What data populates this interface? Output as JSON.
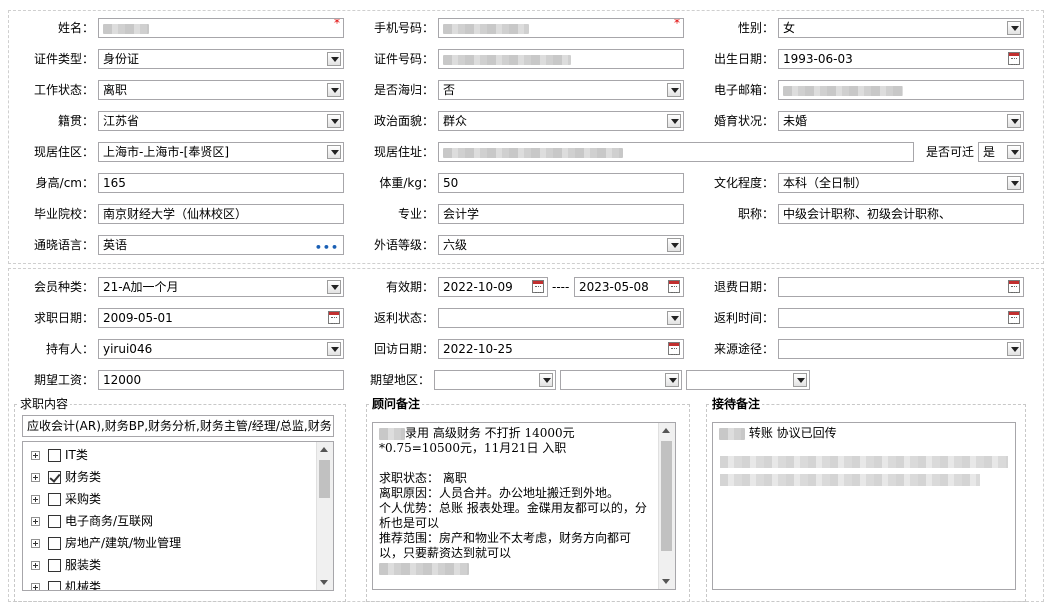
{
  "labels": {
    "name": "姓名：",
    "phone": "手机号码：",
    "gender": "性别：",
    "id_type": "证件类型：",
    "id_no": "证件号码：",
    "birth": "出生日期：",
    "work_status": "工作状态：",
    "overseas": "是否海归：",
    "email": "电子邮箱：",
    "native": "籍贯：",
    "political": "政治面貌：",
    "marital": "婚育状况：",
    "residence_area": "现居住区：",
    "residence_addr": "现居住址：",
    "relocate": "是否可迁",
    "height": "身高/cm：",
    "weight": "体重/kg：",
    "education": "文化程度：",
    "school": "毕业院校：",
    "major": "专业：",
    "title": "职称：",
    "language": "通晓语言：",
    "foreign_level": "外语等级：",
    "member_type": "会员种类：",
    "validity": "有效期：",
    "refund_date": "退费日期：",
    "job_date": "求职日期：",
    "rebate_status": "返利状态：",
    "rebate_time": "返利时间：",
    "holder": "持有人：",
    "visit_date": "回访日期：",
    "source": "来源途径：",
    "salary": "期望工资：",
    "region": "期望地区："
  },
  "required_mark": "*",
  "values": {
    "gender": "女",
    "id_type": "身份证",
    "birth": "1993-06-03",
    "work_status": "离职",
    "overseas": "否",
    "native": "江苏省",
    "political": "群众",
    "marital": "未婚",
    "residence_area": "上海市-上海市-[奉贤区]",
    "relocate": "是",
    "height": "165",
    "weight": "50",
    "education": "本科（全日制）",
    "school": "南京财经大学（仙林校区）",
    "major": "会计学",
    "title": "中级会计职称、初级会计职称、",
    "language": "英语",
    "foreign_level": "六级",
    "member_type": "21-A加一个月",
    "validity_from": "2022-10-09",
    "validity_sep": "----",
    "validity_to": "2023-05-08",
    "refund_date": "",
    "job_date": "2009-05-01",
    "rebate_status": "",
    "rebate_time": "",
    "holder": "yirui046",
    "visit_date": "2022-10-25",
    "source": "",
    "salary": "12000",
    "region_1": "",
    "region_2": "",
    "region_3": ""
  },
  "job_content": {
    "title": "求职内容",
    "summary": "应收会计(AR),财务BP,财务分析,财务主管/经理/总监,财务",
    "tree": [
      {
        "label": "IT类",
        "checked": false
      },
      {
        "label": "财务类",
        "checked": true
      },
      {
        "label": "采购类",
        "checked": false
      },
      {
        "label": "电子商务/互联网",
        "checked": false
      },
      {
        "label": "房地产/建筑/物业管理",
        "checked": false
      },
      {
        "label": "服装类",
        "checked": false
      },
      {
        "label": "机械类",
        "checked": false
      }
    ]
  },
  "advisor_notes": {
    "title": "顾问备注",
    "line1_suffix": "录用 高级财务 不打折 14000元*0.75=10500元，11月21日 入职",
    "line2": "求职状态： 离职",
    "line3": "离职原因：人员合并。办公地址搬迁到外地。",
    "line4": "个人优势：总账 报表处理。金碟用友都可以的，分析也是可以",
    "line5": "推荐范围：房产和物业不太考虑，财务方向都可以，只要薪资达到就可以"
  },
  "reception_notes": {
    "title": "接待备注",
    "line1_suffix": "转账 协议已回传"
  }
}
